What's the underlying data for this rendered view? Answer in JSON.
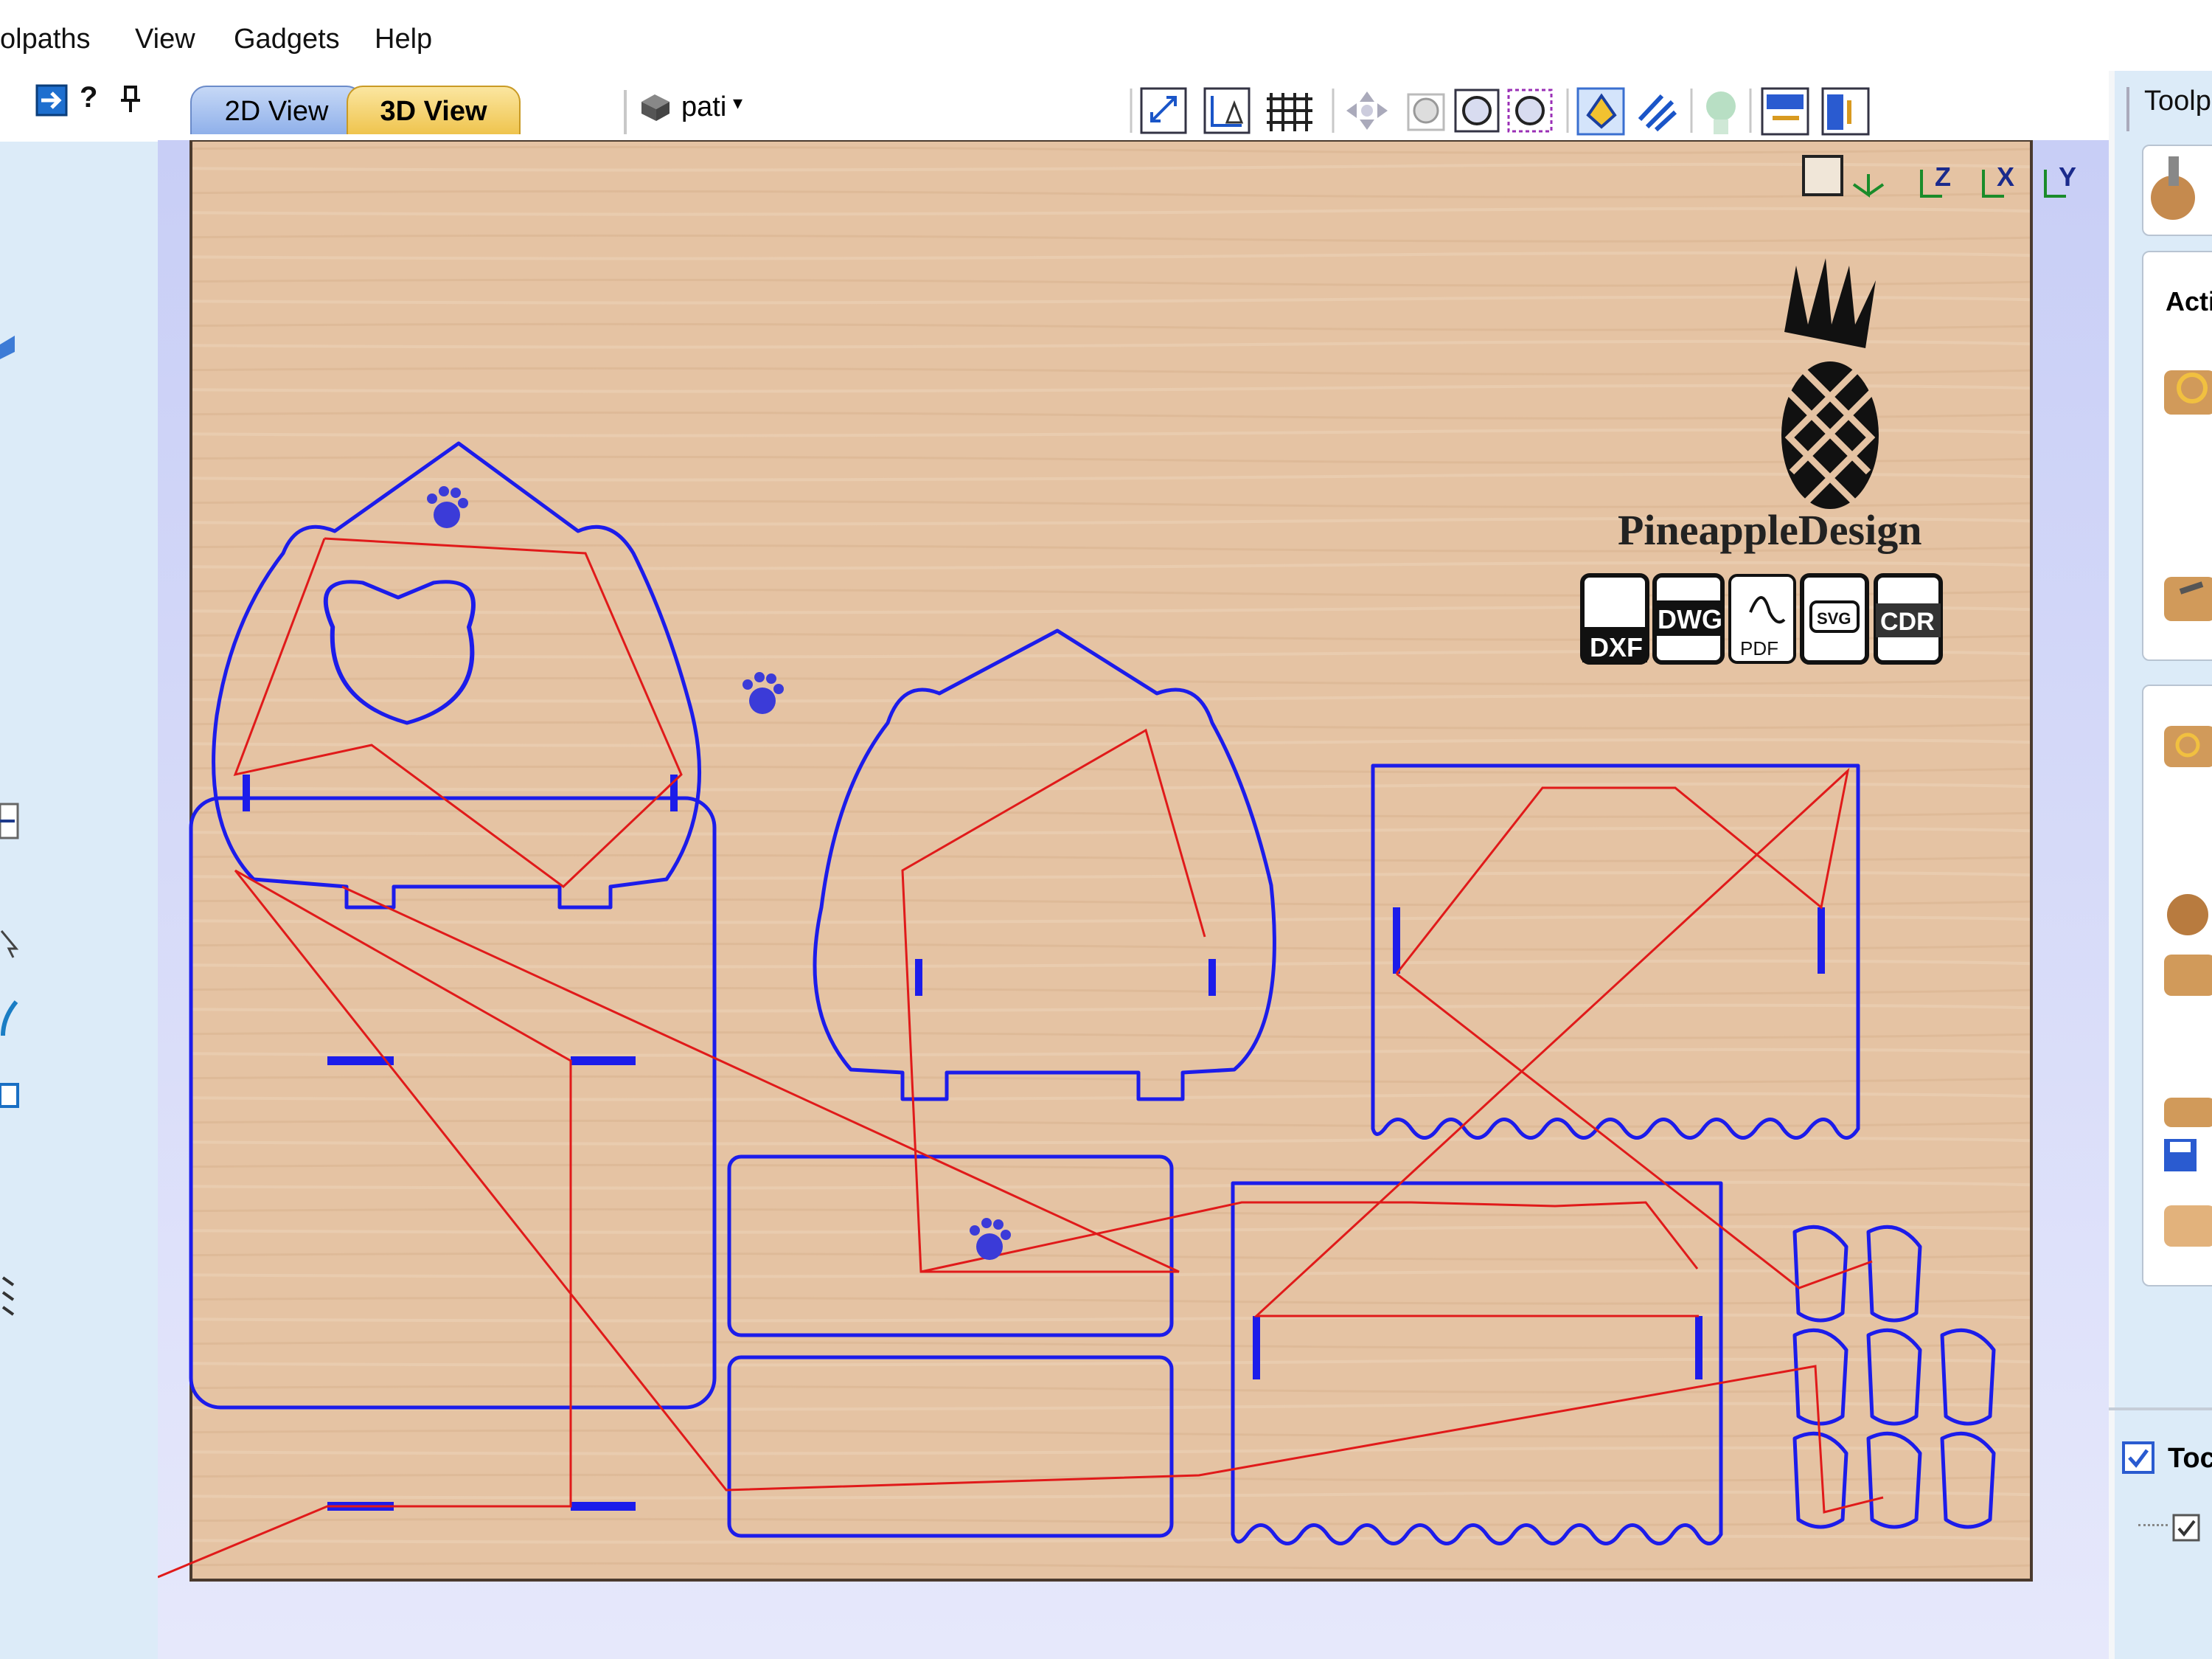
{
  "menu": {
    "items": [
      "olpaths",
      "View",
      "Gadgets",
      "Help"
    ]
  },
  "left_toolbar": {
    "help_label": "?",
    "pin_label": "📌"
  },
  "tabs": [
    {
      "label": "2D View",
      "active": false
    },
    {
      "label": "3D View",
      "active": true
    }
  ],
  "material_selector": {
    "label": "pati"
  },
  "right_panel": {
    "title": "Toolp",
    "actions_heading": "Acti",
    "checkbox_label": "Toc"
  },
  "watermark": {
    "brand": "PineappleDesign",
    "formats": [
      "DXF",
      "DWG",
      "PDF",
      "SVG",
      "CDR"
    ]
  },
  "view_axes": {
    "labels": [
      "Z",
      "X",
      "Y"
    ]
  },
  "colors": {
    "wood": "#e4c2a1",
    "toolpath_outline": "#1919e6",
    "rapid_move": "#e01a1a",
    "tab_active": "#f2d070",
    "tab_inactive": "#a6bfee",
    "panel_bg": "#dcebf8",
    "viewport_bg": "#ccd1f5"
  }
}
